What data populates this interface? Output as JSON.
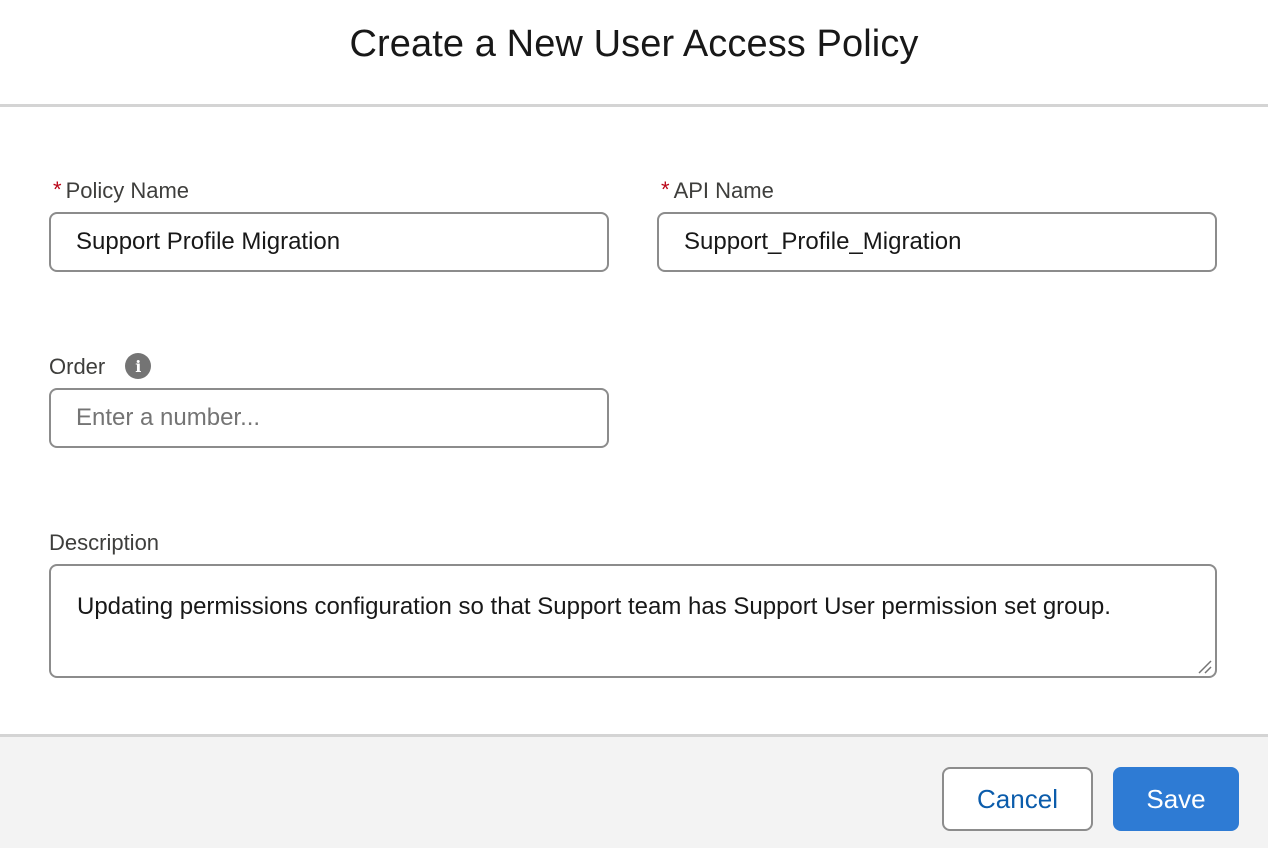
{
  "header": {
    "title": "Create a New User Access Policy"
  },
  "form": {
    "policy_name": {
      "required_marker": "*",
      "label": "Policy Name",
      "value": "Support Profile Migration"
    },
    "api_name": {
      "required_marker": "*",
      "label": "API Name",
      "value": "Support_Profile_Migration"
    },
    "order": {
      "label": "Order",
      "placeholder": "Enter a number...",
      "value": "",
      "info_icon": "info-icon",
      "info_glyph": "i"
    },
    "description": {
      "label": "Description",
      "value": "Updating permissions configuration so that Support team has Support User permission set group."
    }
  },
  "footer": {
    "cancel_label": "Cancel",
    "save_label": "Save"
  },
  "colors": {
    "required": "#ba0517",
    "brand": "#2e7bd4",
    "link_text": "#0b5cab",
    "footer_bg": "#f3f3f3",
    "border": "#8c8c8c"
  }
}
